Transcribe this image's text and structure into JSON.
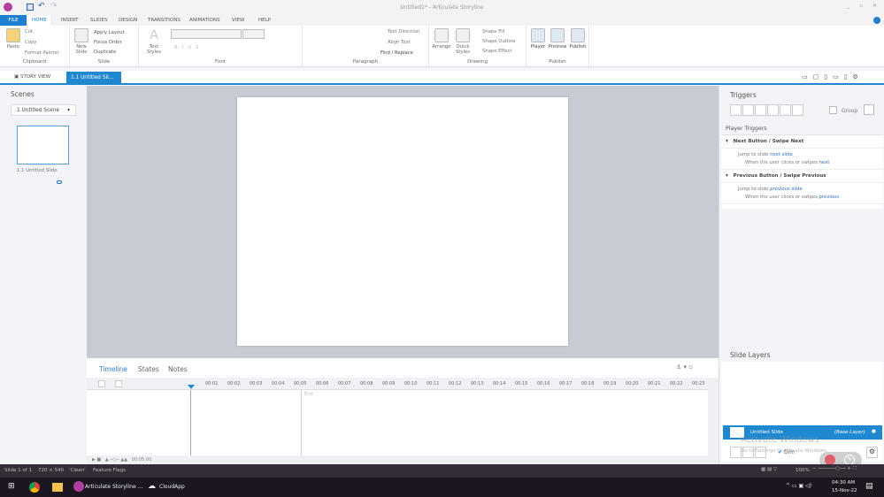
{
  "window": {
    "title": "Untitled1* - Articulate Storyline"
  },
  "menu_tabs": [
    "FILE",
    "HOME",
    "INSERT",
    "SLIDES",
    "DESIGN",
    "TRANSITIONS",
    "ANIMATIONS",
    "VIEW",
    "HELP"
  ],
  "ribbon": {
    "clipboard": {
      "label": "Clipboard",
      "paste": "Paste",
      "cut": "Cut",
      "copy": "Copy",
      "format_painter": "Format Painter"
    },
    "slide": {
      "label": "Slide",
      "new_slide": "New Slide",
      "apply_layout": "Apply Layout",
      "focus_order": "Focus Order",
      "duplicate": "Duplicate"
    },
    "font": {
      "label": "Font",
      "text_styles": "Text Styles"
    },
    "paragraph": {
      "label": "Paragraph",
      "text_direction": "Text Direction",
      "align_text": "Align Text",
      "find_replace": "Find / Replace"
    },
    "drawing": {
      "label": "Drawing",
      "arrange": "Arrange",
      "quick_styles": "Quick Styles",
      "shape_fill": "Shape Fill",
      "shape_outline": "Shape Outline",
      "shape_effect": "Shape Effect"
    },
    "publish": {
      "label": "Publish",
      "player": "Player",
      "preview": "Preview",
      "publish": "Publish"
    }
  },
  "views": {
    "story_view": "STORY VIEW",
    "slide_tab": "1.1 Untitled Sli..."
  },
  "scenes": {
    "title": "Scenes",
    "selected_scene": "1 Untitled Scene",
    "slide_label": "1.1 Untitled Slide"
  },
  "timeline": {
    "tabs": [
      "Timeline",
      "States",
      "Notes"
    ],
    "ticks": [
      "00:01",
      "00:02",
      "00:03",
      "00:04",
      "00:05",
      "00:06",
      "00:07",
      "00:08",
      "00:09",
      "00:10",
      "00:11",
      "00:12",
      "00:13",
      "00:14",
      "00:15",
      "00:16",
      "00:17",
      "00:18",
      "00:19",
      "00:20",
      "00:21",
      "00:22",
      "00:23"
    ],
    "end_label": "End",
    "duration": "00:05.00"
  },
  "triggers": {
    "title": "Triggers",
    "group_label": "Group",
    "player_triggers": "Player Triggers",
    "items": [
      {
        "name": "Next Button / Swipe Next",
        "action": "Jump to slide",
        "target": "next slide",
        "condition": "When the user clicks or swipes",
        "cond_target": "next"
      },
      {
        "name": "Previous Button / Swipe Previous",
        "action": "Jump to slide",
        "target": "previous slide",
        "condition": "When the user clicks or swipes",
        "cond_target": "previous"
      }
    ]
  },
  "layers": {
    "title": "Slide Layers",
    "base_name": "Untitled Slide",
    "base_tag": "(Base Layer)",
    "dim_label": "Dim",
    "watermark1": "Activate Windows",
    "watermark2": "Go to Settings to activate Windows."
  },
  "status": {
    "slide": "Slide 1 of 1",
    "size": "720 × 540",
    "theme": "'Clean'",
    "flags": "Feature Flags",
    "zoom": "100%"
  },
  "taskbar": {
    "apps": [
      "Articulate Storyline ...",
      "CloudApp"
    ],
    "time": "04:30 AM",
    "date": "15-Nov-22"
  },
  "colors": {
    "accent": "#1e88d0",
    "status_bg": "#332d38"
  }
}
